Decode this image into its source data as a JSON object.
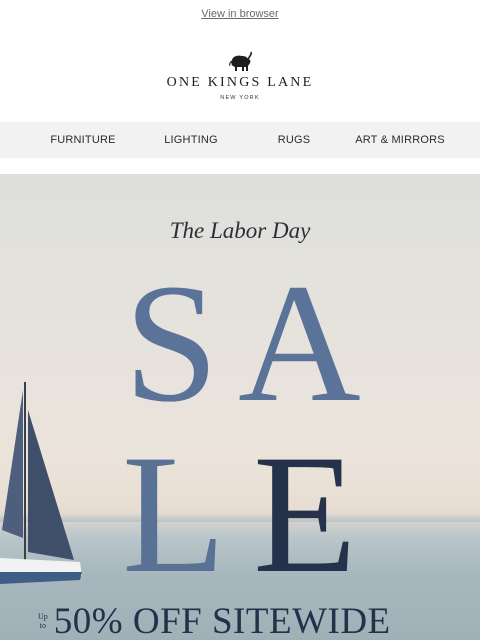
{
  "header": {
    "view_in_browser": "View in browser",
    "brand_name": "ONE KINGS LANE",
    "brand_sub": "NEW YORK",
    "logo_icon": "elephant-icon"
  },
  "nav": {
    "items": [
      {
        "label": "FURNITURE"
      },
      {
        "label": "LIGHTING"
      },
      {
        "label": "RUGS"
      },
      {
        "label": "ART & MIRRORS"
      }
    ]
  },
  "hero": {
    "subtitle": "The Labor Day",
    "letters": [
      "S",
      "A",
      "L",
      "E"
    ],
    "offer_prefix_1": "Up",
    "offer_prefix_2": "to",
    "offer_text": "50% OFF SITEWIDE",
    "colors": {
      "sale_blue": "#5b7398",
      "sale_navy": "#26324b"
    }
  }
}
